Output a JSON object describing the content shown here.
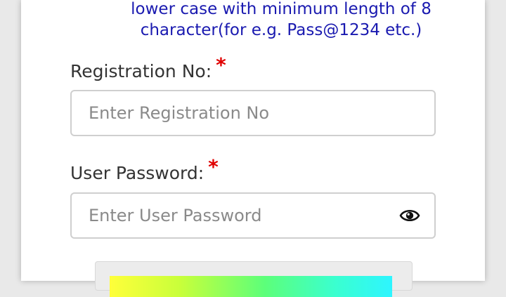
{
  "password_hint": {
    "line1": "lower case with minimum length of 8",
    "line2": "character(for e.g. Pass@1234 etc.)"
  },
  "registration": {
    "label": "Registration No:",
    "required_mark": "*",
    "placeholder": "Enter Registration No",
    "value": ""
  },
  "password": {
    "label": "User Password:",
    "required_mark": "*",
    "placeholder": "Enter User Password",
    "value": "",
    "toggle_icon": "eye-icon"
  },
  "colors": {
    "hint_text": "#1a1ab0",
    "required": "#e00000",
    "label_text": "#333333",
    "field_border": "#cfcfcf"
  }
}
